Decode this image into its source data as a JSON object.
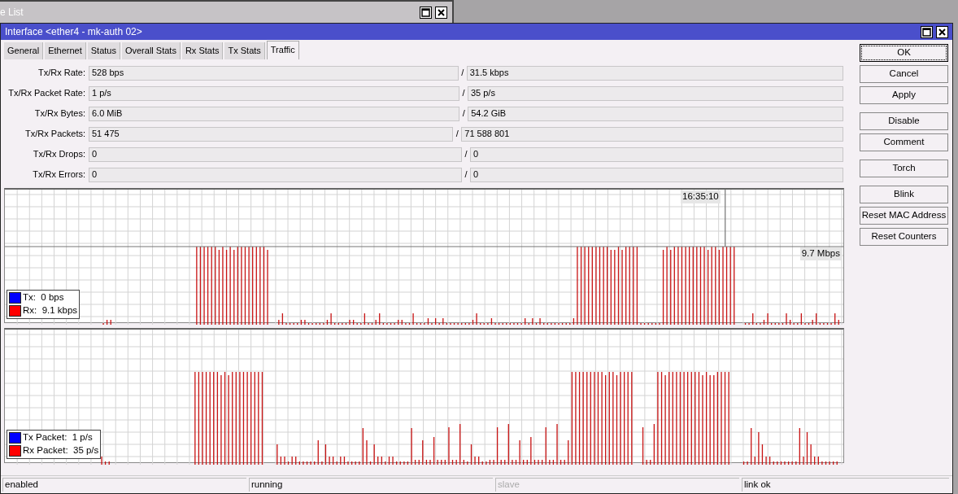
{
  "background_window": {
    "title": "e List"
  },
  "window": {
    "title": "Interface <ether4 - mk-auth 02>"
  },
  "tabs": [
    {
      "label": "General",
      "selected": false
    },
    {
      "label": "Ethernet",
      "selected": false
    },
    {
      "label": "Status",
      "selected": false
    },
    {
      "label": "Overall Stats",
      "selected": false
    },
    {
      "label": "Rx Stats",
      "selected": false
    },
    {
      "label": "Tx Stats",
      "selected": false
    },
    {
      "label": "Traffic",
      "selected": true
    }
  ],
  "stats": [
    {
      "label": "Tx/Rx Rate:",
      "tx": "528 bps",
      "separator": "/",
      "rx": "31.5 kbps"
    },
    {
      "label": "Tx/Rx Packet Rate:",
      "tx": "1 p/s",
      "separator": "/",
      "rx": "35 p/s"
    },
    {
      "label": "Tx/Rx Bytes:",
      "tx": "6.0 MiB",
      "separator": "/",
      "rx": "54.2 GiB"
    },
    {
      "label": "Tx/Rx Packets:",
      "tx": "51 475",
      "separator": "/",
      "rx": "71 588 801"
    },
    {
      "label": "Tx/Rx Drops:",
      "tx": "0",
      "separator": "/",
      "rx": "0"
    },
    {
      "label": "Tx/Rx Errors:",
      "tx": "0",
      "separator": "/",
      "rx": "0"
    }
  ],
  "graphs": [
    {
      "time_label": "16:35:10",
      "scale_label": "9.7 Mbps",
      "legend": [
        {
          "text": "Tx:  0 bps",
          "color": "#0000ff"
        },
        {
          "text": "Rx:  9.1 kbps",
          "color": "#ff0000"
        }
      ]
    },
    {
      "legend": [
        {
          "text": "Tx Packet:  1 p/s",
          "color": "#0000ff"
        },
        {
          "text": "Rx Packet:  35 p/s",
          "color": "#ff0000"
        }
      ]
    }
  ],
  "button_groups": [
    [
      {
        "label": "OK",
        "focused": true
      },
      {
        "label": "Cancel",
        "focused": false
      },
      {
        "label": "Apply",
        "focused": false
      }
    ],
    [
      {
        "label": "Disable",
        "focused": false
      },
      {
        "label": "Comment",
        "focused": false
      }
    ],
    [
      {
        "label": "Torch",
        "focused": false
      }
    ],
    [
      {
        "label": "Blink",
        "focused": false
      },
      {
        "label": "Reset MAC Address",
        "focused": false
      },
      {
        "label": "Reset Counters",
        "focused": false
      }
    ]
  ],
  "status_bar": [
    {
      "text": "enabled",
      "disabled": false
    },
    {
      "text": "running",
      "disabled": false
    },
    {
      "text": "slave",
      "disabled": true
    },
    {
      "text": "link ok",
      "disabled": false
    }
  ]
}
